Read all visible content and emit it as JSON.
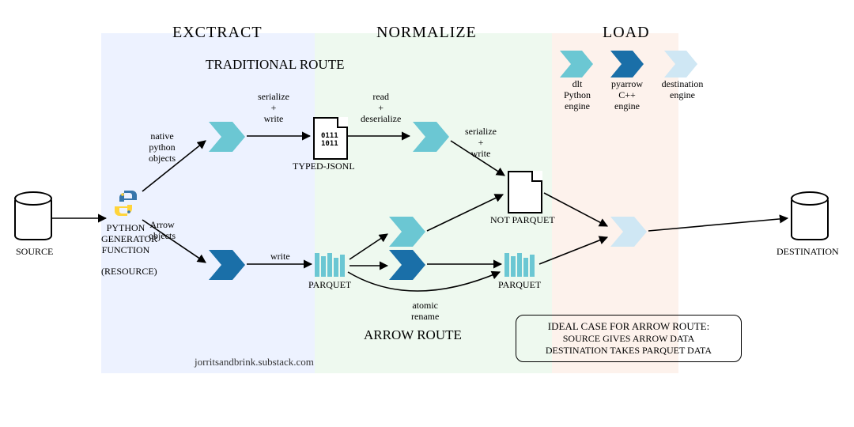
{
  "headers": {
    "extract": "EXCTRACT",
    "normalize": "NORMALIZE",
    "load": "LOAD"
  },
  "routes": {
    "top": "TRADITIONAL ROUTE",
    "bottom": "ARROW ROUTE"
  },
  "endpoints": {
    "source": "SOURCE",
    "destination": "DESTINATION"
  },
  "gen": {
    "l1": "PYTHON",
    "l2": "GENERATOR",
    "l3": "FUNCTION",
    "l4": "(RESOURCE)"
  },
  "labels": {
    "native1": "native",
    "native2": "python",
    "native3": "objects",
    "arrow1": "Arrow",
    "arrow2": "objects",
    "sw1": "serialize",
    "sw2": "+",
    "sw3": "write",
    "rd1": "read",
    "rd2": "+",
    "rd3": "deserialize",
    "write": "write",
    "typedjsonl": "TYPED-JSONL",
    "parquet1": "PARQUET",
    "parquet2": "PARQUET",
    "notparq": "NOT PARQUET",
    "atomic1": "atomic",
    "atomic2": "rename"
  },
  "legend": {
    "dlt1": "dlt",
    "dlt2": "Python",
    "dlt3": "engine",
    "py1": "pyarrow",
    "py2": "C++",
    "py3": "engine",
    "de1": "destination",
    "de2": "engine"
  },
  "note": {
    "title": "IDEAL CASE FOR ARROW ROUTE:",
    "l1": "SOURCE GIVES ARROW DATA",
    "l2": "DESTINATION TAKES PARQUET DATA"
  },
  "attribution": "jorritsandbrink.substack.com",
  "file_bits": {
    "l1": "0111",
    "l2": "1011"
  },
  "colors": {
    "light": "#6bc7d3",
    "dark": "#1a6fa8",
    "pale": "#cfe7f4"
  }
}
